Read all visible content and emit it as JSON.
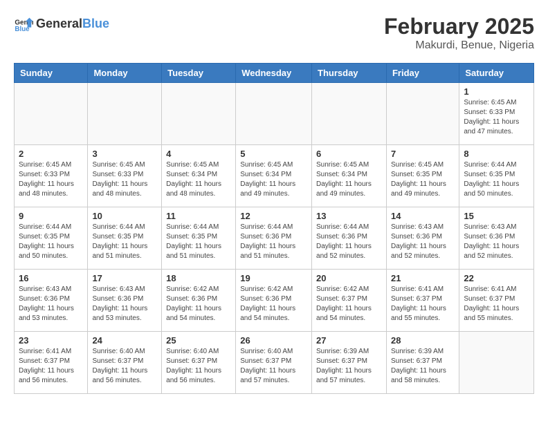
{
  "header": {
    "logo_general": "General",
    "logo_blue": "Blue",
    "month_year": "February 2025",
    "location": "Makurdi, Benue, Nigeria"
  },
  "days_of_week": [
    "Sunday",
    "Monday",
    "Tuesday",
    "Wednesday",
    "Thursday",
    "Friday",
    "Saturday"
  ],
  "weeks": [
    [
      {
        "day": "",
        "info": ""
      },
      {
        "day": "",
        "info": ""
      },
      {
        "day": "",
        "info": ""
      },
      {
        "day": "",
        "info": ""
      },
      {
        "day": "",
        "info": ""
      },
      {
        "day": "",
        "info": ""
      },
      {
        "day": "1",
        "info": "Sunrise: 6:45 AM\nSunset: 6:33 PM\nDaylight: 11 hours and 47 minutes."
      }
    ],
    [
      {
        "day": "2",
        "info": "Sunrise: 6:45 AM\nSunset: 6:33 PM\nDaylight: 11 hours and 48 minutes."
      },
      {
        "day": "3",
        "info": "Sunrise: 6:45 AM\nSunset: 6:33 PM\nDaylight: 11 hours and 48 minutes."
      },
      {
        "day": "4",
        "info": "Sunrise: 6:45 AM\nSunset: 6:34 PM\nDaylight: 11 hours and 48 minutes."
      },
      {
        "day": "5",
        "info": "Sunrise: 6:45 AM\nSunset: 6:34 PM\nDaylight: 11 hours and 49 minutes."
      },
      {
        "day": "6",
        "info": "Sunrise: 6:45 AM\nSunset: 6:34 PM\nDaylight: 11 hours and 49 minutes."
      },
      {
        "day": "7",
        "info": "Sunrise: 6:45 AM\nSunset: 6:35 PM\nDaylight: 11 hours and 49 minutes."
      },
      {
        "day": "8",
        "info": "Sunrise: 6:44 AM\nSunset: 6:35 PM\nDaylight: 11 hours and 50 minutes."
      }
    ],
    [
      {
        "day": "9",
        "info": "Sunrise: 6:44 AM\nSunset: 6:35 PM\nDaylight: 11 hours and 50 minutes."
      },
      {
        "day": "10",
        "info": "Sunrise: 6:44 AM\nSunset: 6:35 PM\nDaylight: 11 hours and 51 minutes."
      },
      {
        "day": "11",
        "info": "Sunrise: 6:44 AM\nSunset: 6:35 PM\nDaylight: 11 hours and 51 minutes."
      },
      {
        "day": "12",
        "info": "Sunrise: 6:44 AM\nSunset: 6:36 PM\nDaylight: 11 hours and 51 minutes."
      },
      {
        "day": "13",
        "info": "Sunrise: 6:44 AM\nSunset: 6:36 PM\nDaylight: 11 hours and 52 minutes."
      },
      {
        "day": "14",
        "info": "Sunrise: 6:43 AM\nSunset: 6:36 PM\nDaylight: 11 hours and 52 minutes."
      },
      {
        "day": "15",
        "info": "Sunrise: 6:43 AM\nSunset: 6:36 PM\nDaylight: 11 hours and 52 minutes."
      }
    ],
    [
      {
        "day": "16",
        "info": "Sunrise: 6:43 AM\nSunset: 6:36 PM\nDaylight: 11 hours and 53 minutes."
      },
      {
        "day": "17",
        "info": "Sunrise: 6:43 AM\nSunset: 6:36 PM\nDaylight: 11 hours and 53 minutes."
      },
      {
        "day": "18",
        "info": "Sunrise: 6:42 AM\nSunset: 6:36 PM\nDaylight: 11 hours and 54 minutes."
      },
      {
        "day": "19",
        "info": "Sunrise: 6:42 AM\nSunset: 6:36 PM\nDaylight: 11 hours and 54 minutes."
      },
      {
        "day": "20",
        "info": "Sunrise: 6:42 AM\nSunset: 6:37 PM\nDaylight: 11 hours and 54 minutes."
      },
      {
        "day": "21",
        "info": "Sunrise: 6:41 AM\nSunset: 6:37 PM\nDaylight: 11 hours and 55 minutes."
      },
      {
        "day": "22",
        "info": "Sunrise: 6:41 AM\nSunset: 6:37 PM\nDaylight: 11 hours and 55 minutes."
      }
    ],
    [
      {
        "day": "23",
        "info": "Sunrise: 6:41 AM\nSunset: 6:37 PM\nDaylight: 11 hours and 56 minutes."
      },
      {
        "day": "24",
        "info": "Sunrise: 6:40 AM\nSunset: 6:37 PM\nDaylight: 11 hours and 56 minutes."
      },
      {
        "day": "25",
        "info": "Sunrise: 6:40 AM\nSunset: 6:37 PM\nDaylight: 11 hours and 56 minutes."
      },
      {
        "day": "26",
        "info": "Sunrise: 6:40 AM\nSunset: 6:37 PM\nDaylight: 11 hours and 57 minutes."
      },
      {
        "day": "27",
        "info": "Sunrise: 6:39 AM\nSunset: 6:37 PM\nDaylight: 11 hours and 57 minutes."
      },
      {
        "day": "28",
        "info": "Sunrise: 6:39 AM\nSunset: 6:37 PM\nDaylight: 11 hours and 58 minutes."
      },
      {
        "day": "",
        "info": ""
      }
    ]
  ]
}
